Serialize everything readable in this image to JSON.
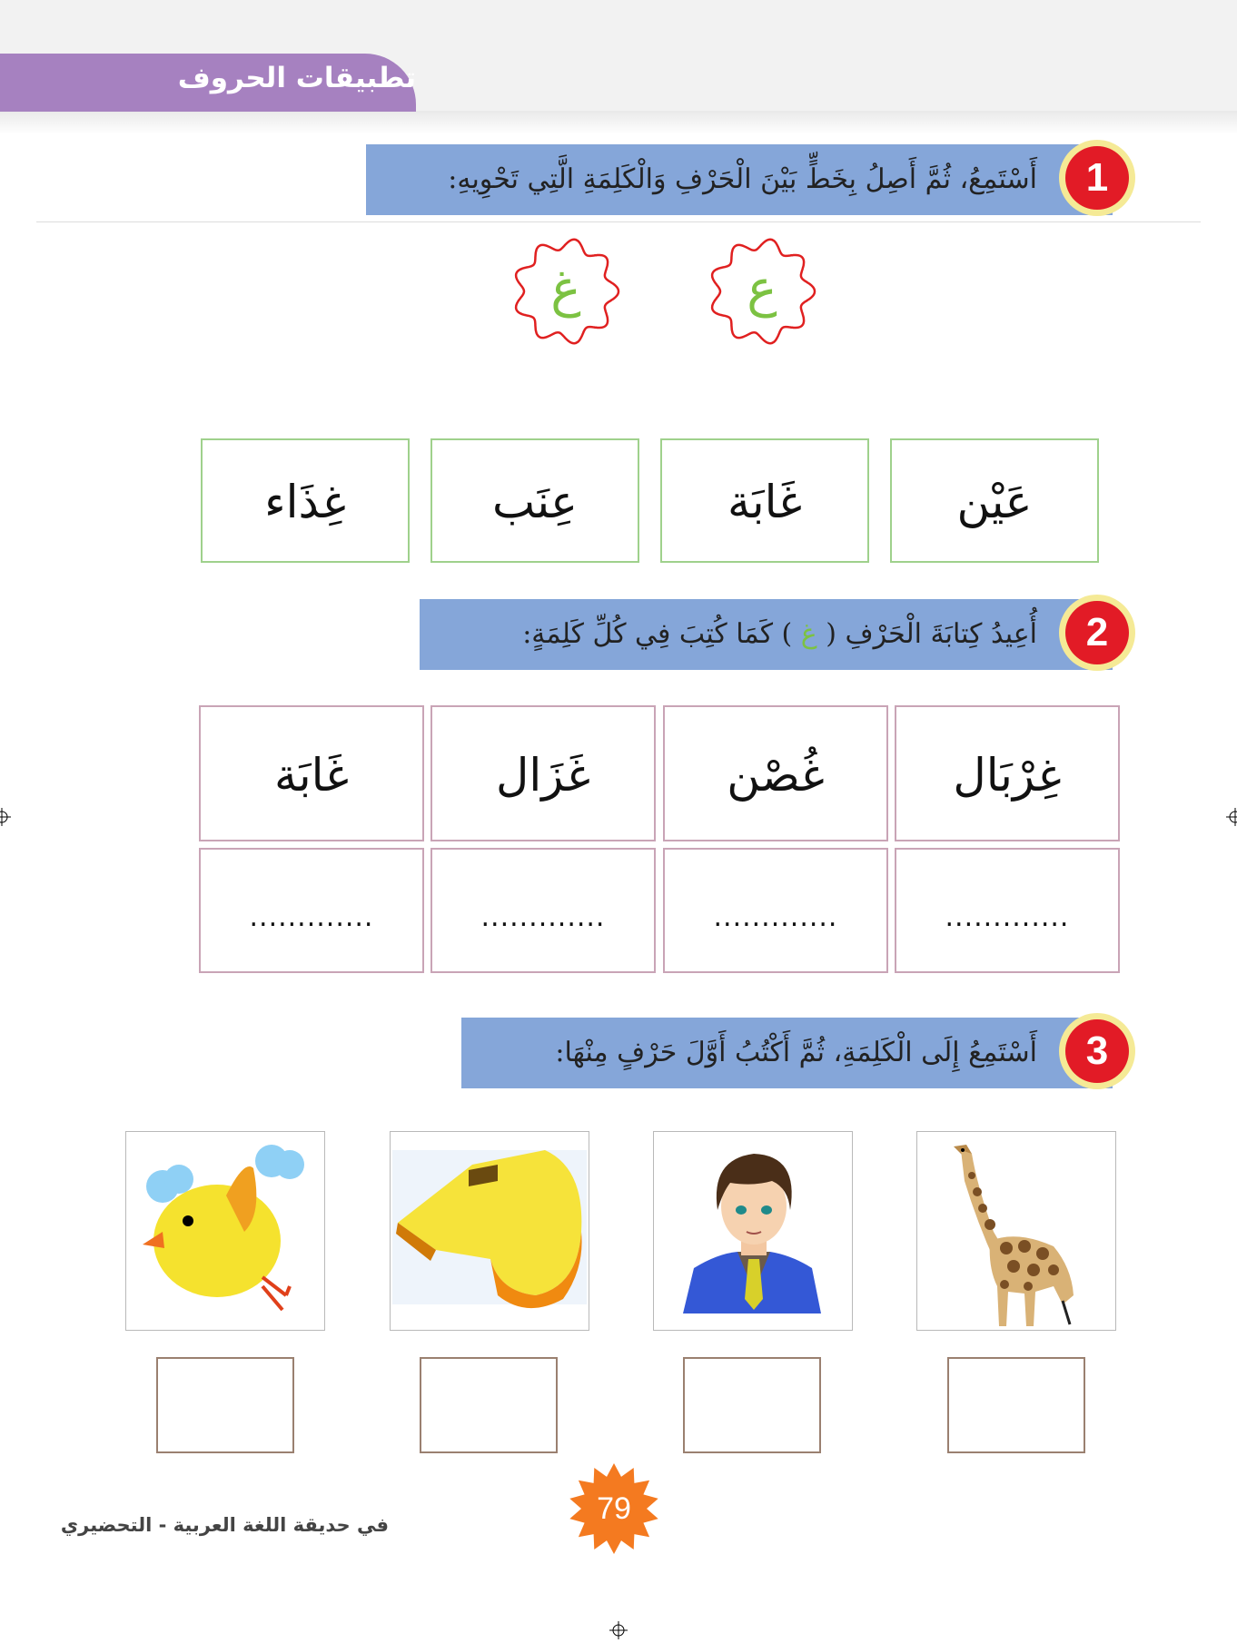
{
  "header": {
    "title": "تطبيقات الحروف"
  },
  "exercises": [
    {
      "number": "1",
      "instruction": "أَسْتَمِعُ، ثُمَّ أَصِلُ بِخَطٍّ بَيْنَ الْحَرْفِ وَالْكَلِمَةِ الَّتِي تَحْوِيهِ:"
    },
    {
      "number": "2",
      "instruction_before": "أُعِيدُ كِتابَةَ الْحَرْفِ (",
      "instruction_letter": "غ",
      "instruction_after": ") كَمَا كُتِبَ فِي كُلِّ كَلِمَةٍ:"
    },
    {
      "number": "3",
      "instruction": "أَسْتَمِعُ إِلَى الْكَلِمَةِ، ثُمَّ أَكْتُبُ أَوَّلَ حَرْفٍ مِنْهَا:"
    }
  ],
  "letters": [
    "ع",
    "غ"
  ],
  "match_words": [
    "عَيْن",
    "غَابَة",
    "عِنَب",
    "غِذَاء"
  ],
  "rewrite_words": [
    "غِرْبَال",
    "غُصْن",
    "غَزَال",
    "غَابَة"
  ],
  "blank": ".............",
  "pictures": [
    "giraffe-icon",
    "man-icon",
    "whistle-icon",
    "bird-icon"
  ],
  "footer": {
    "page_number": "79",
    "book_title": "في حديقة اللغة العربية - التحضيري"
  },
  "colors": {
    "purple": "#a681c0",
    "banner": "#85a6d9",
    "badge_red": "#e21b26",
    "letter_green": "#7cc242",
    "star_orange": "#f47a20"
  }
}
